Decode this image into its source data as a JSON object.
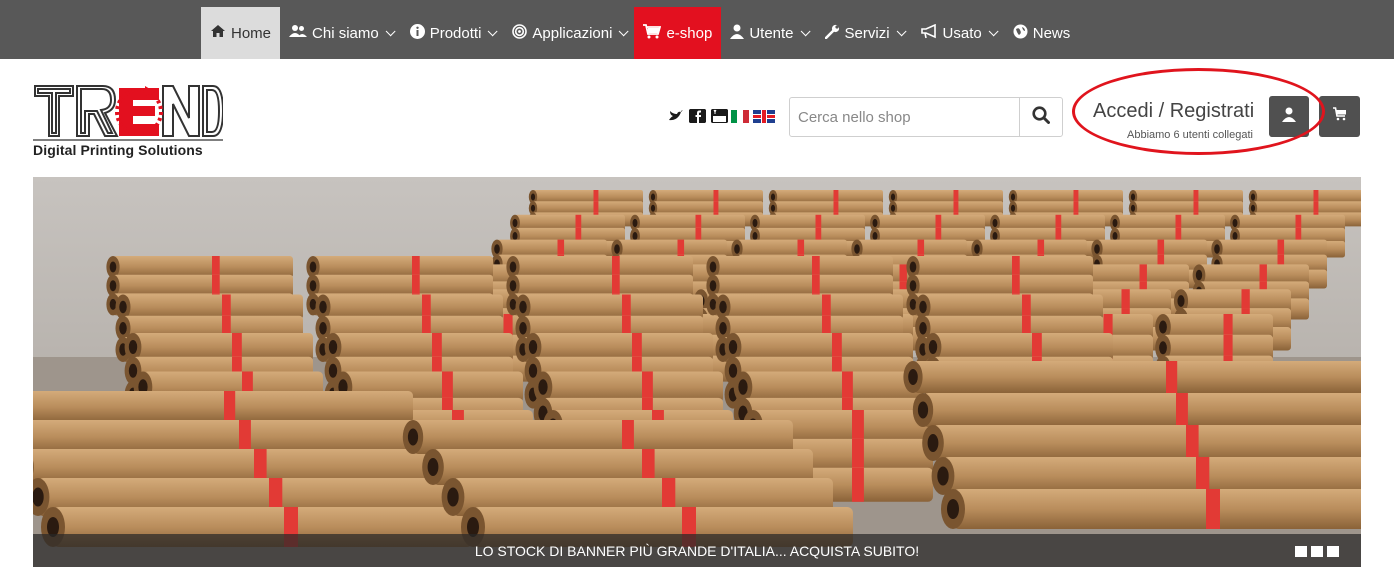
{
  "nav": {
    "items": [
      {
        "label": "Home",
        "icon": "home-icon",
        "dropdown": false
      },
      {
        "label": "Chi siamo",
        "icon": "users-icon",
        "dropdown": true
      },
      {
        "label": "Prodotti",
        "icon": "info-icon",
        "dropdown": true
      },
      {
        "label": "Applicazioni",
        "icon": "target-icon",
        "dropdown": true
      },
      {
        "label": "e-shop",
        "icon": "cart-icon",
        "dropdown": false
      },
      {
        "label": "Utente",
        "icon": "user-icon",
        "dropdown": true
      },
      {
        "label": "Servizi",
        "icon": "wrench-icon",
        "dropdown": true
      },
      {
        "label": "Usato",
        "icon": "megaphone-icon",
        "dropdown": true
      },
      {
        "label": "News",
        "icon": "globe-icon",
        "dropdown": false
      }
    ],
    "active": "Home",
    "highlight": "e-shop"
  },
  "logo": {
    "wordmark": "TREND",
    "tagline": "Digital Printing Solutions"
  },
  "social": [
    "twitter-icon",
    "facebook-icon",
    "youtube-icon"
  ],
  "languages": [
    "it-flag-icon",
    "uk-flag-icon"
  ],
  "search": {
    "placeholder": "Cerca nello shop"
  },
  "account": {
    "login_label": "Accedi / Registrati",
    "users_online": "Abbiamo 6 utenti collegati"
  },
  "slider": {
    "caption": "LO STOCK DI BANNER PIÙ GRANDE D'ITALIA... ACQUISTA SUBITO!",
    "slide_count": 3
  },
  "colors": {
    "nav_bg": "#585858",
    "shop_red": "#e3101f",
    "annotation_red": "#e0141d",
    "button_dark": "#505050"
  }
}
